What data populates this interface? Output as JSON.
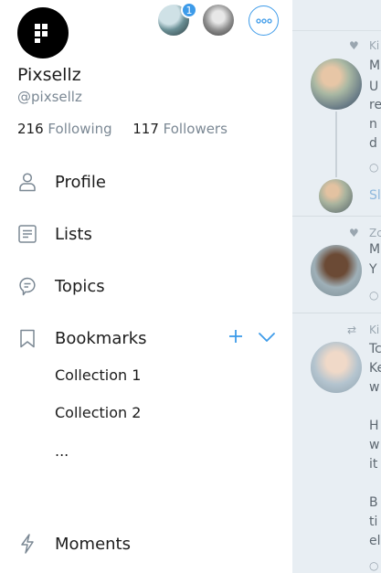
{
  "profile": {
    "name": "Pixsellz",
    "handle": "@pixsellz",
    "following_count": "216",
    "following_label": "Following",
    "followers_count": "117",
    "followers_label": "Followers",
    "account_badge": "1"
  },
  "nav": {
    "profile": "Profile",
    "lists": "Lists",
    "topics": "Topics",
    "bookmarks": "Bookmarks",
    "collection_1": "Collection 1",
    "collection_2": "Collection 2",
    "more": "...",
    "moments": "Moments"
  },
  "icons": {
    "more_options": "more-horizontal-icon",
    "profile": "person-icon",
    "lists": "list-icon",
    "topics": "topic-bubble-icon",
    "bookmarks": "bookmark-icon",
    "add": "plus-icon",
    "expand": "chevron-down-icon",
    "moments": "lightning-icon"
  },
  "timeline": {
    "tweet1_meta": "Ki",
    "tweet1_lines": [
      "M",
      "U",
      "re",
      "n",
      "d"
    ],
    "tweet1_show": "Sl",
    "tweet2_meta": "Zc",
    "tweet2_lines": [
      "M",
      "Y"
    ],
    "tweet3_meta": "Ki",
    "tweet3_lines": [
      "Tc",
      "Ke",
      "w",
      "",
      "H",
      "w",
      "it",
      "",
      "B",
      "ti",
      "el"
    ]
  },
  "colors": {
    "accent": "#3d9be9",
    "text_primary": "#1c1c1c",
    "text_secondary": "#7b8894"
  }
}
